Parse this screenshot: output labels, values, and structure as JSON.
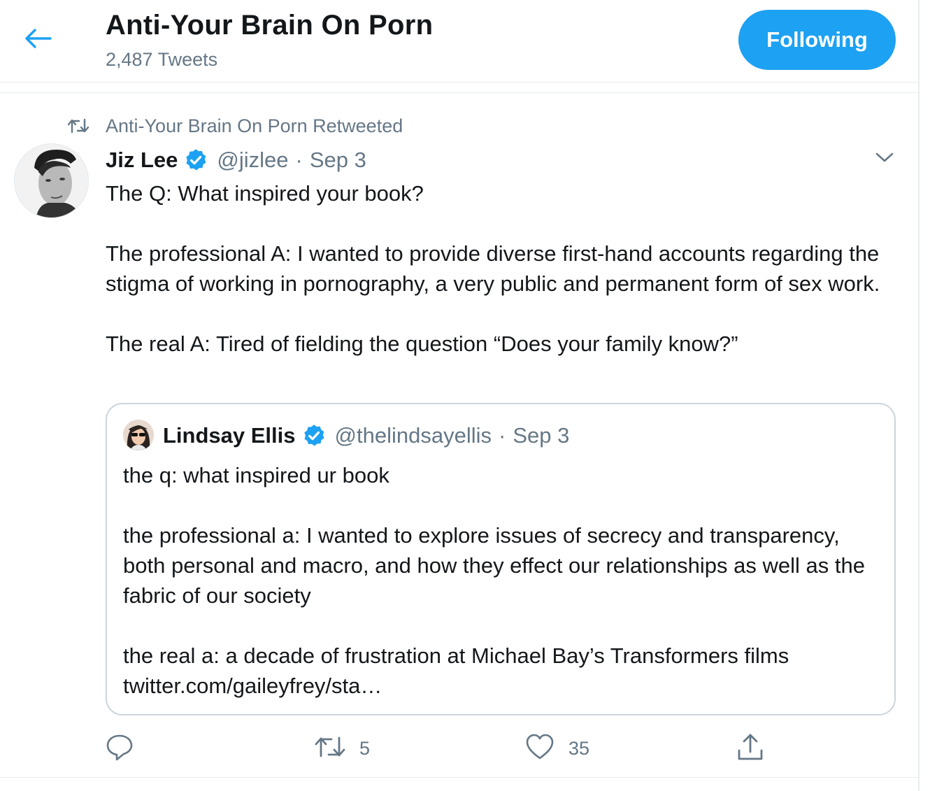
{
  "header": {
    "title": "Anti-Your Brain On Porn",
    "tweet_count": "2,487 Tweets",
    "follow_label": "Following",
    "back_icon": "arrow-left-icon"
  },
  "tweet": {
    "retweeted_by": "Anti-Your Brain On Porn Retweeted",
    "author": {
      "name": "Jiz Lee",
      "handle": "@jizlee",
      "verified": true
    },
    "separator": "·",
    "date": "Sep 3",
    "paragraphs": [
      "The Q: What inspired your book?",
      "The professional A: I wanted to provide diverse first-hand accounts regarding the stigma of working in pornography, a very public and permanent form of sex work.",
      "The real A: Tired of fielding the question “Does your family know?”"
    ],
    "quote": {
      "author": {
        "name": "Lindsay Ellis",
        "handle": "@thelindsayellis",
        "verified": true
      },
      "date": "Sep 3",
      "paragraphs": [
        "the q: what inspired ur book",
        "the professional a: I wanted to explore issues of secrecy and transparency, both personal and macro, and how they effect our relationships as well as the fabric of our society",
        "the real a: a decade of frustration at Michael Bay’s Transformers films twitter.com/gaileyfrey/sta…"
      ]
    },
    "actions": {
      "reply_count": "",
      "retweet_count": "5",
      "like_count": "35"
    }
  },
  "colors": {
    "accent": "#1da1f2",
    "text_primary": "#14171a",
    "text_secondary": "#657786",
    "border": "#e6ecf0"
  }
}
